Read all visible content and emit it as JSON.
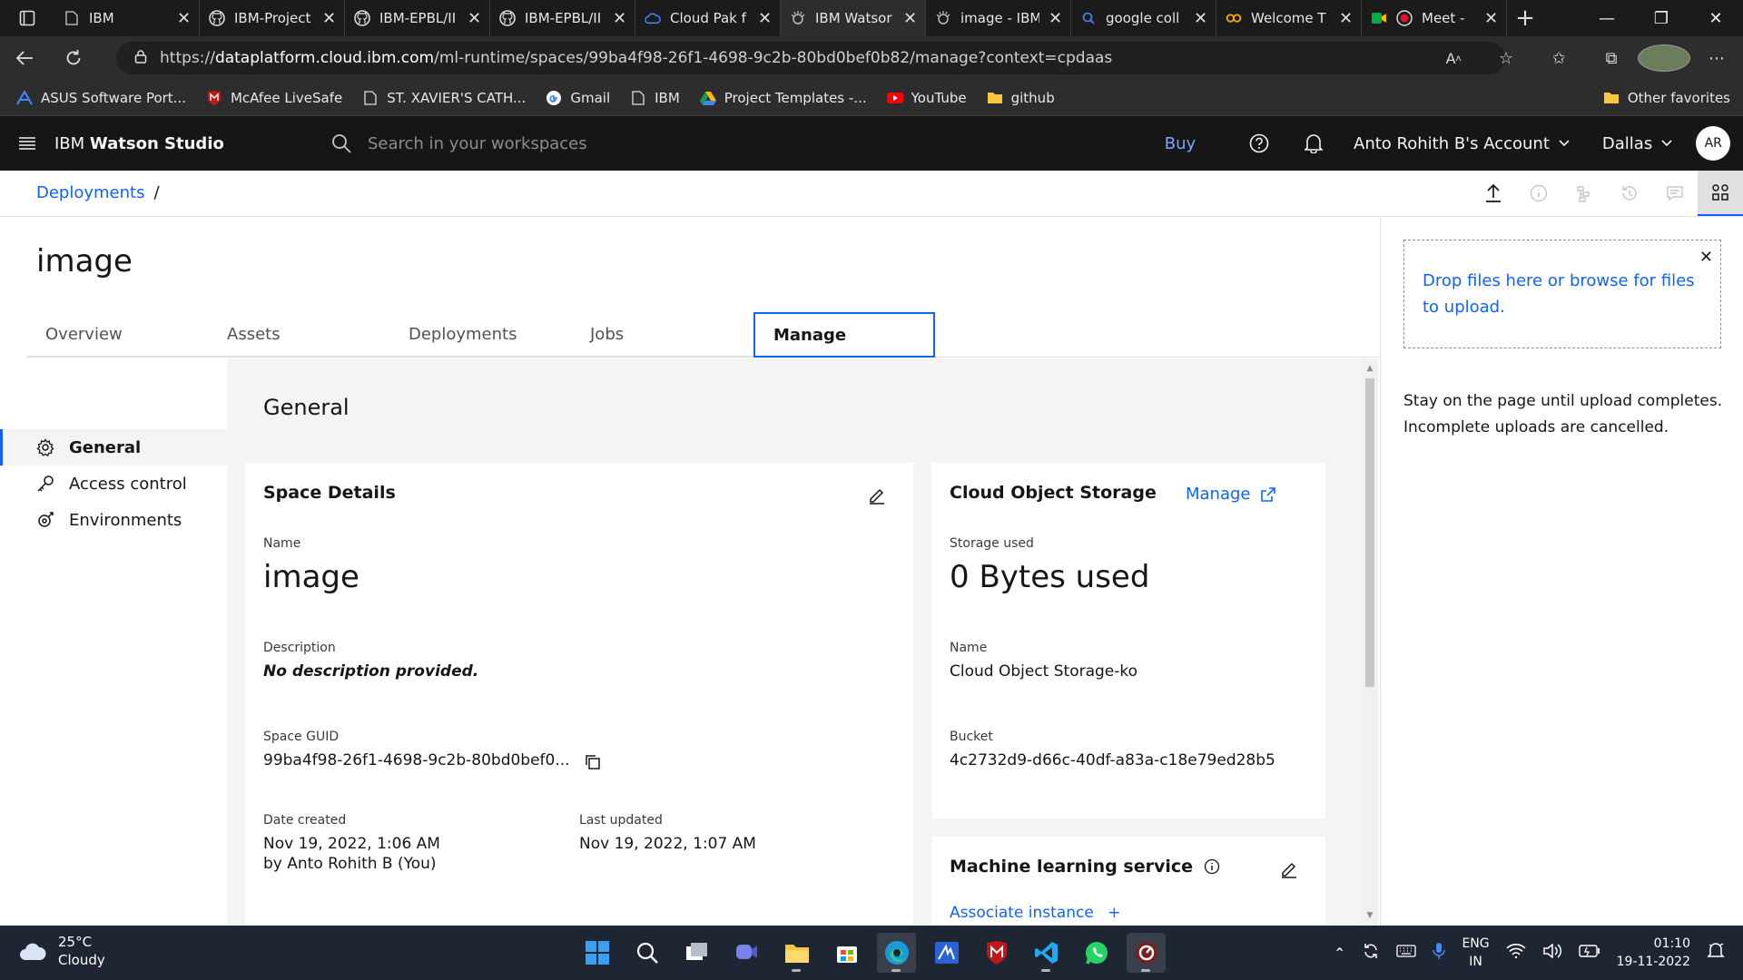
{
  "browser": {
    "tabs": [
      {
        "title": "IBM",
        "icon": "page-icon",
        "active": false
      },
      {
        "title": "IBM-Project",
        "icon": "github-icon",
        "active": false
      },
      {
        "title": "IBM-EPBL/II",
        "icon": "github-icon",
        "active": false
      },
      {
        "title": "IBM-EPBL/II",
        "icon": "github-icon",
        "active": false
      },
      {
        "title": "Cloud Pak f",
        "icon": "cloud-icon",
        "active": false
      },
      {
        "title": "IBM Watsor",
        "icon": "watson-icon",
        "active": true
      },
      {
        "title": "image - IBM",
        "icon": "watson-icon",
        "active": false
      },
      {
        "title": "google coll",
        "icon": "search-icon",
        "active": false
      },
      {
        "title": "Welcome T",
        "icon": "colab-icon",
        "active": false
      },
      {
        "title": "Meet -",
        "icon": "meet-icon",
        "active": false
      }
    ],
    "url_scheme": "https://",
    "url_host": "dataplatform.cloud.ibm.com",
    "url_path": "/ml-runtime/spaces/99ba4f98-26f1-4698-9c2b-80bd0bef0b82/manage?context=cpdaas",
    "favorites": [
      {
        "label": "ASUS Software Port...",
        "icon": "asus-icon"
      },
      {
        "label": "McAfee LiveSafe",
        "icon": "mcafee-icon"
      },
      {
        "label": "ST. XAVIER'S CATH...",
        "icon": "page-icon"
      },
      {
        "label": "Gmail",
        "icon": "google-icon"
      },
      {
        "label": "IBM",
        "icon": "page-icon"
      },
      {
        "label": "Project Templates -...",
        "icon": "drive-icon"
      },
      {
        "label": "YouTube",
        "icon": "youtube-icon"
      },
      {
        "label": "github",
        "icon": "folder-icon"
      }
    ],
    "other_favorites": "Other favorites"
  },
  "header": {
    "product_prefix": "IBM ",
    "product_name": "Watson Studio",
    "search_placeholder": "Search in your workspaces",
    "buy": "Buy",
    "account": "Anto Rohith B's Account",
    "region": "Dallas",
    "avatar_initials": "AR"
  },
  "breadcrumb": {
    "item": "Deployments",
    "sep": "/"
  },
  "page": {
    "title": "image",
    "tabs": [
      "Overview",
      "Assets",
      "Deployments",
      "Jobs",
      "Manage"
    ],
    "active_tab": "Manage"
  },
  "leftnav": [
    {
      "label": "General",
      "icon": "gear-icon",
      "active": true
    },
    {
      "label": "Access control",
      "icon": "key-icon",
      "active": false
    },
    {
      "label": "Environments",
      "icon": "environment-icon",
      "active": false
    }
  ],
  "general": {
    "title": "General",
    "space_details": {
      "title": "Space Details",
      "name_label": "Name",
      "name": "image",
      "description_label": "Description",
      "description": "No description provided.",
      "guid_label": "Space GUID",
      "guid": "99ba4f98-26f1-4698-9c2b-80bd0bef0...",
      "date_created_label": "Date created",
      "date_created": "Nov 19, 2022, 1:06 AM",
      "created_by": "by Anto Rohith B (You)",
      "last_updated_label": "Last updated",
      "last_updated": "Nov 19, 2022, 1:07 AM"
    },
    "cos": {
      "title": "Cloud Object Storage",
      "manage": "Manage",
      "storage_label": "Storage used",
      "storage": "0 Bytes used",
      "name_label": "Name",
      "name": "Cloud Object Storage-ko",
      "bucket_label": "Bucket",
      "bucket": "4c2732d9-d66c-40df-a83a-c18e79ed28b5"
    },
    "ml": {
      "title": "Machine learning service",
      "associate": "Associate instance",
      "associate_plus": "+"
    }
  },
  "upload_panel": {
    "drop_text": "Drop files here or browse for files to upload.",
    "note": "Stay on the page until upload completes. Incomplete uploads are cancelled."
  },
  "taskbar": {
    "temp": "25°C",
    "condition": "Cloudy",
    "lang_top": "ENG",
    "lang_bottom": "IN",
    "time": "01:10",
    "date": "19-11-2022"
  },
  "colors": {
    "accent": "#0f62fe",
    "header_bg": "#161616",
    "content_bg": "#f4f4f4"
  }
}
